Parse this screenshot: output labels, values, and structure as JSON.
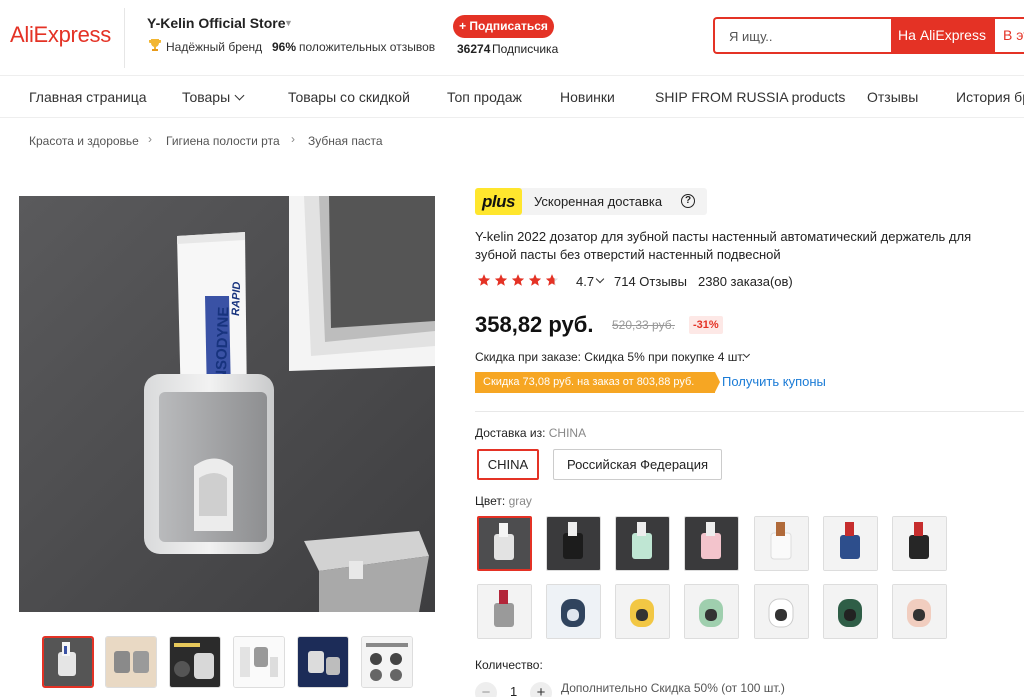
{
  "header": {
    "logo": "AliExpress",
    "store_name": "Y-Kelin Official Store",
    "brand_badge": "Надёжный бренд",
    "positive_pct": "96%",
    "positive_label": "положительных отзывов",
    "subscribe_label": "+ Подписаться",
    "subscribers_count": "36274",
    "subscribers_label": "Подписчика",
    "search_placeholder": "Я ищу..",
    "search_button": "На AliExpress",
    "search_button2": "В этом"
  },
  "nav": {
    "items": [
      "Главная страница",
      "Товары",
      "Товары со скидкой",
      "Топ продаж",
      "Новинки",
      "SHIP FROM RUSSIA products",
      "Отзывы",
      "История бренда"
    ]
  },
  "breadcrumb": [
    "Красота и здоровье",
    "Гигиена полости рта",
    "Зубная паста"
  ],
  "product": {
    "plus_logo": "plus",
    "plus_label": "Ускоренная доставка",
    "title": "Y-kelin 2022 дозатор для зубной пасты настенный автоматический держатель для зубной пасты без отверстий настенный подвесной",
    "rating": "4.7",
    "reviews": "714 Отзывы",
    "orders": "2380 заказа(ов)",
    "price": "358,82 руб.",
    "old_price": "520,33 руб.",
    "discount": "-31%",
    "order_discount": "Скидка при заказе: Скидка 5% при покупке 4 шт.",
    "coupon_text": "Скидка 73,08 руб. на заказ от 803,88 руб.",
    "coupon_link": "Получить купоны",
    "ship_from_label": "Доставка из:",
    "ship_from_value": "CHINA",
    "ship_options": [
      "CHINA",
      "Российская Федерация"
    ],
    "color_label": "Цвет:",
    "color_value": "gray",
    "quantity_label": "Количество:",
    "quantity": "1",
    "quantity_discount": "Дополнительно Скидка 50% (от 100 шт.)"
  },
  "image": {
    "tube_brand": "SENSODYNE",
    "tube_sub": "RAPID"
  },
  "colors": {
    "accent": "#e43225",
    "coupon": "#f6a623",
    "link": "#1a7bd6",
    "plus_yellow": "#ffe62d"
  }
}
